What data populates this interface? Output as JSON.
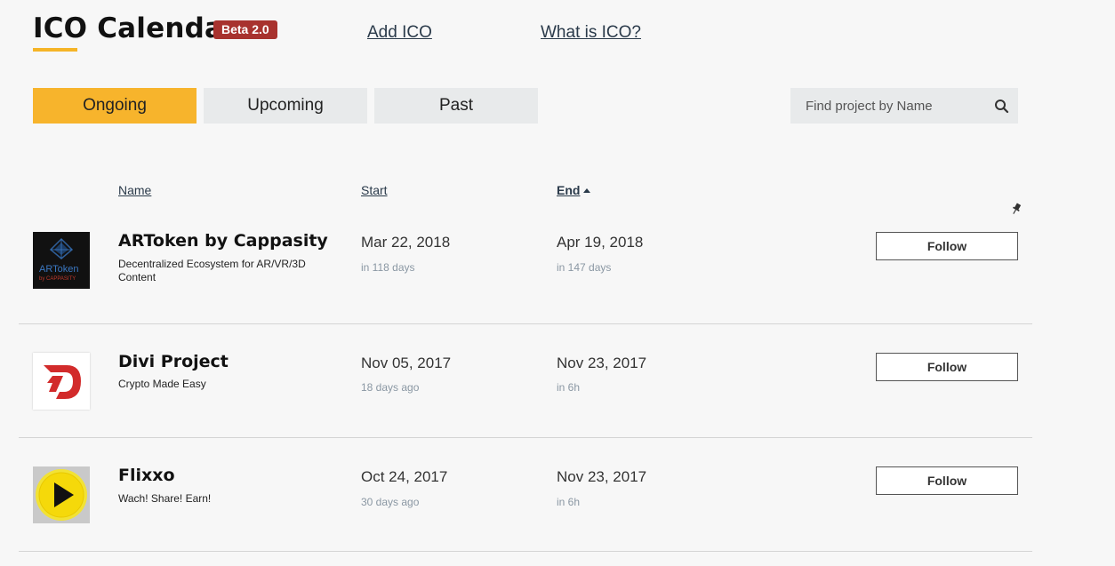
{
  "header": {
    "title": "ICO Calendar",
    "beta_badge": "Beta 2.0",
    "nav": {
      "add_ico": "Add ICO",
      "what_is_ico": "What is ICO?"
    }
  },
  "tabs": [
    {
      "label": "Ongoing",
      "active": true
    },
    {
      "label": "Upcoming",
      "active": false
    },
    {
      "label": "Past",
      "active": false
    }
  ],
  "search": {
    "placeholder": "Find project by Name",
    "value": ""
  },
  "columns": {
    "name": "Name",
    "start": "Start",
    "end": "End",
    "sorted_by": "End",
    "sort_direction": "ascending"
  },
  "colors": {
    "accent": "#f7b42c",
    "badge": "#a8322e",
    "tab_inactive": "#e8eaeb",
    "muted_text": "#8a97a3"
  },
  "projects": [
    {
      "name": "ARToken by Cappasity",
      "description": "Decentralized Ecosystem for AR/VR/3D Content",
      "start_date": "Mar 22, 2018",
      "start_relative": "in 118 days",
      "end_date": "Apr 19, 2018",
      "end_relative": "in 147 days",
      "follow_label": "Follow",
      "logo_text": "ARToken",
      "logo_subtext": "by CAPPASITY"
    },
    {
      "name": "Divi Project",
      "description": "Crypto Made Easy",
      "start_date": "Nov 05, 2017",
      "start_relative": "18 days ago",
      "end_date": "Nov 23, 2017",
      "end_relative": "in 6h",
      "follow_label": "Follow"
    },
    {
      "name": "Flixxo",
      "description": "Wach! Share! Earn!",
      "start_date": "Oct 24, 2017",
      "start_relative": "30 days ago",
      "end_date": "Nov 23, 2017",
      "end_relative": "in 6h",
      "follow_label": "Follow"
    }
  ],
  "icons": [
    "search-icon",
    "pin-icon",
    "sort-up-icon"
  ]
}
